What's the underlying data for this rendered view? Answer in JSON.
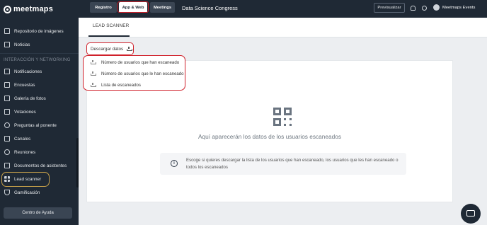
{
  "app": {
    "logo_text": "meetmaps"
  },
  "sidebar": {
    "items_top": [
      {
        "label": "Repositorio de imágenes",
        "icon": "image-icon"
      },
      {
        "label": "Noticias",
        "icon": "news-icon"
      }
    ],
    "section_label": "INTERACCIÓN Y NETWORKING",
    "items": [
      {
        "label": "Notificaciones",
        "icon": "bell-icon"
      },
      {
        "label": "Encuestas",
        "icon": "poll-icon"
      },
      {
        "label": "Galería de fotos",
        "icon": "photo-gallery-icon"
      },
      {
        "label": "Votaciones",
        "icon": "chart-icon"
      },
      {
        "label": "Preguntas al ponente",
        "icon": "chat-icon"
      },
      {
        "label": "Canales",
        "icon": "folder-icon"
      },
      {
        "label": "Reuniones",
        "icon": "meetings-icon"
      },
      {
        "label": "Documentos de asistentes",
        "icon": "documents-icon"
      },
      {
        "label": "Lead scanner",
        "icon": "grid-icon",
        "active": true
      },
      {
        "label": "Gamificación",
        "icon": "trophy-icon"
      }
    ],
    "help_label": "Centro de Ayuda"
  },
  "topbar": {
    "tabs": [
      "Registro",
      "App & Web",
      "Meetings"
    ],
    "event_title": "Data Science Congress",
    "preview_label": "Previsualizar",
    "user_name": "Meetmaps Events"
  },
  "main": {
    "tab_label": "LEAD SCANNER",
    "download_label": "Descargar datos",
    "dropdown_items": [
      "Número de usuarios que han escaneado",
      "Número de usuarios que le han escaneado",
      "Lista de escaneados"
    ],
    "empty_text": "Aquí aparecerán los datos de los usuarios escaneados",
    "info_text": "Escoge si quieres descargar la lista de los usuarios que han escaneado, los usuarios que les han escaneado o todos los escaneados"
  },
  "colors": {
    "sidebar_bg": "#1f2935",
    "highlight_red": "#d0202a",
    "active_outline": "#c8a14a"
  }
}
